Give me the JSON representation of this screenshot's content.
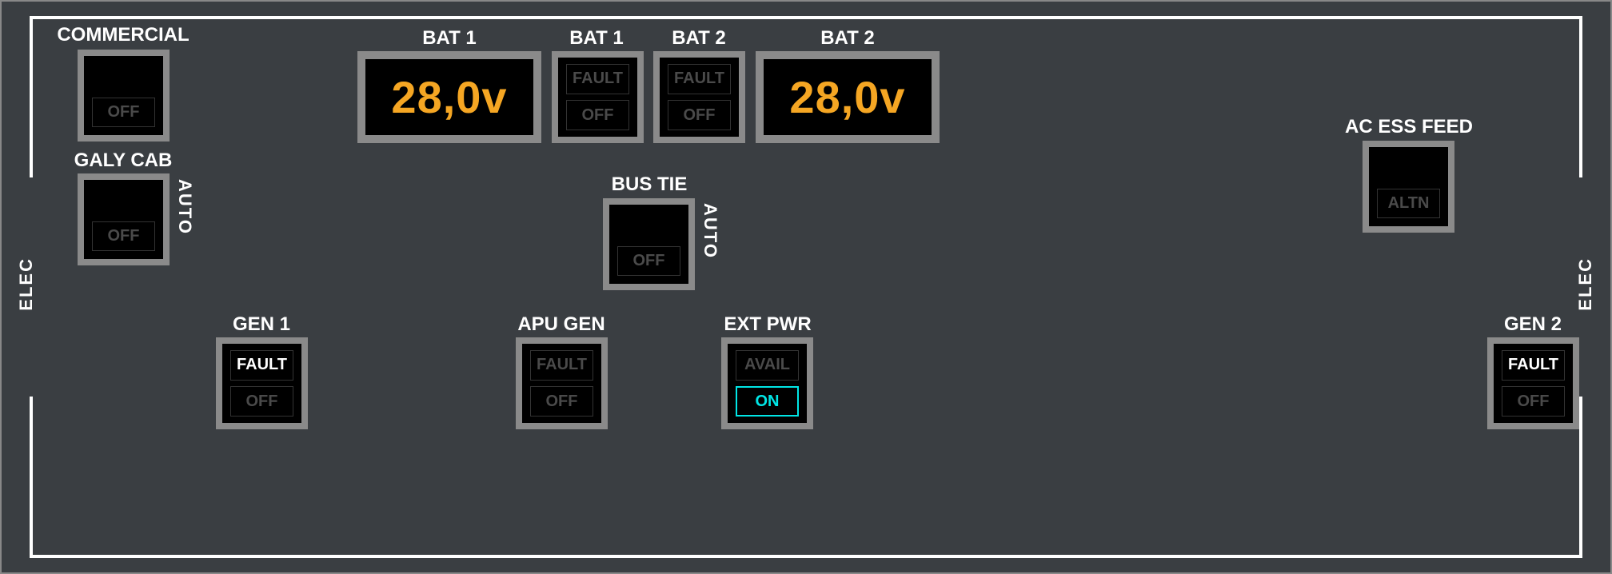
{
  "panel": {
    "section_label": "ELEC"
  },
  "commercial": {
    "title": "COMMERCIAL",
    "off": "OFF"
  },
  "galy_cab": {
    "title": "GALY CAB",
    "off": "OFF",
    "auto": "AUTO"
  },
  "bat1_disp": {
    "title": "BAT 1",
    "value": "28,0v"
  },
  "bat1_btn": {
    "title": "BAT 1",
    "fault": "FAULT",
    "off": "OFF"
  },
  "bat2_btn": {
    "title": "BAT 2",
    "fault": "FAULT",
    "off": "OFF"
  },
  "bat2_disp": {
    "title": "BAT 2",
    "value": "28,0v"
  },
  "bus_tie": {
    "title": "BUS TIE",
    "off": "OFF",
    "auto": "AUTO"
  },
  "ac_ess": {
    "title": "AC ESS FEED",
    "altn": "ALTN"
  },
  "gen1": {
    "title": "GEN 1",
    "fault": "FAULT",
    "off": "OFF"
  },
  "apu_gen": {
    "title": "APU GEN",
    "fault": "FAULT",
    "off": "OFF"
  },
  "ext_pwr": {
    "title": "EXT PWR",
    "avail": "AVAIL",
    "on": "ON"
  },
  "gen2": {
    "title": "GEN 2",
    "fault": "FAULT",
    "off": "OFF"
  }
}
